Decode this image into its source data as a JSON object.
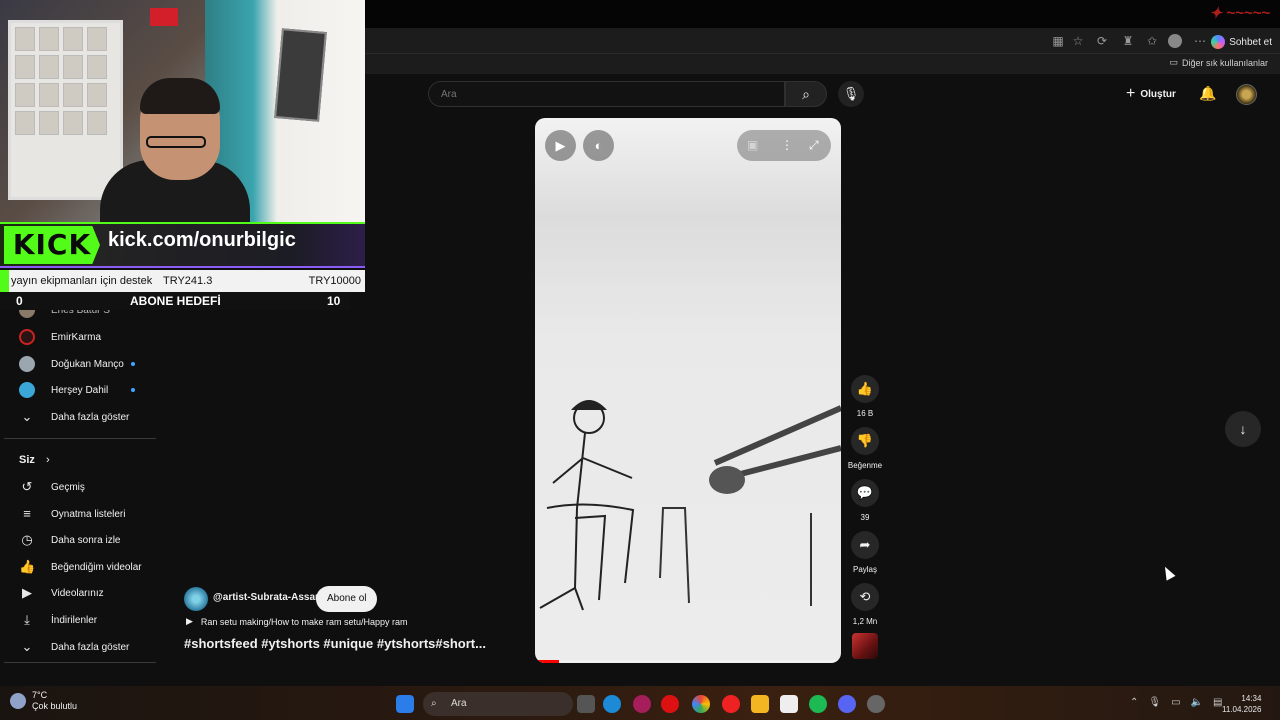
{
  "browser": {
    "chat_label": "Sohbet et",
    "other_bookmarks": "Diğer sık kullanılanlar"
  },
  "overlay": {
    "kick_logo": "KICK",
    "kick_url": "kick.com/onurbilgic",
    "donation_label": "yayın ekipmanları için destek",
    "donation_current": "TRY241.3",
    "donation_goal": "TRY10000",
    "donation_progress": 0.024,
    "sub_goal_label": "ABONE HEDEFİ",
    "sub_goal_current": "0",
    "sub_goal_target": "10"
  },
  "header": {
    "search_placeholder": "Ara",
    "create_label": "Oluştur"
  },
  "sidebar": {
    "subscriptions": [
      {
        "label": "Enes Batur S",
        "new": false
      },
      {
        "label": "EmirKarma",
        "new": false
      },
      {
        "label": "Doğukan Manço",
        "new": true
      },
      {
        "label": "Herşey Dahil",
        "new": true
      }
    ],
    "show_more": "Daha fazla göster",
    "you_label": "Siz",
    "you_items": [
      {
        "label": "Geçmiş",
        "icon": "history-icon"
      },
      {
        "label": "Oynatma listeleri",
        "icon": "playlists-icon"
      },
      {
        "label": "Daha sonra izle",
        "icon": "watch-later-icon"
      },
      {
        "label": "Beğendiğim videolar",
        "icon": "liked-icon"
      },
      {
        "label": "Videolarınız",
        "icon": "your-videos-icon"
      },
      {
        "label": "İndirilenler",
        "icon": "downloads-icon"
      }
    ],
    "show_more_2": "Daha fazla göster"
  },
  "short": {
    "progress": 0.08,
    "likes": "16 B",
    "dislike_label": "Beğenme",
    "comments": "39",
    "share_label": "Paylaş",
    "remix_count": "1,2 Mn",
    "channel": "@artist-Subrata-Assam",
    "subscribe_label": "Abone ol",
    "sound_title": "Ran setu making/How to make ram setu/Happy ram",
    "tags": "#shortsfeed #ytshorts #unique #ytshorts#short..."
  },
  "taskbar": {
    "temperature": "7°C",
    "weather": "Çok bulutlu",
    "search_label": "Ara",
    "time": "14:34",
    "date": "11.04.2026"
  }
}
